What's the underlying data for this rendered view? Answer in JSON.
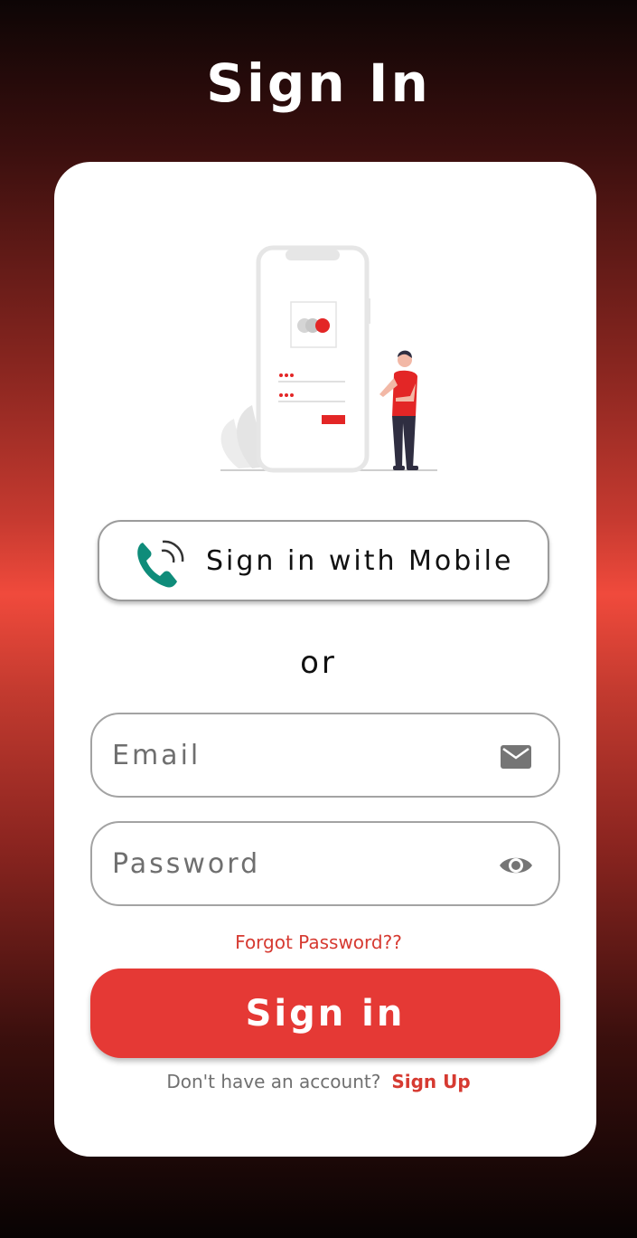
{
  "header": {
    "title": "Sign In"
  },
  "mobile_signin": {
    "label": "Sign in with Mobile",
    "icon": "phone-call-icon"
  },
  "divider": {
    "text": "or"
  },
  "email": {
    "placeholder": "Email",
    "value": "",
    "icon": "mail-icon"
  },
  "password": {
    "placeholder": "Password",
    "value": "",
    "icon": "eye-icon"
  },
  "forgot_label": "Forgot Password??",
  "submit_label": "Sign in",
  "signup": {
    "question": "Don't have an account?",
    "link_label": "Sign Up"
  },
  "colors": {
    "accent": "#e53935",
    "link": "#d63a31",
    "phone_icon": "#0f8c7a"
  }
}
